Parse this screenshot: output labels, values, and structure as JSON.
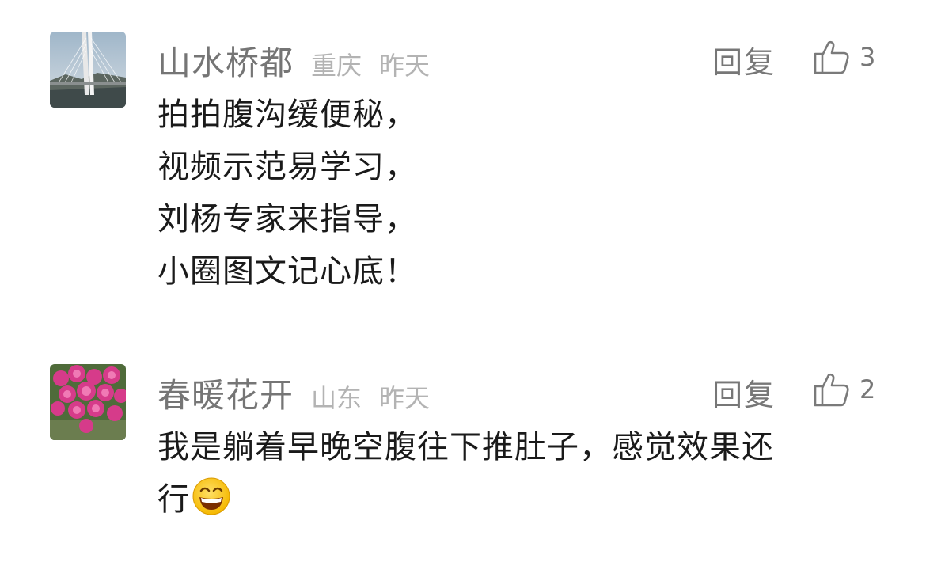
{
  "comments": [
    {
      "username": "山水桥都",
      "location": "重庆",
      "time": "昨天",
      "reply_label": "回复",
      "like_icon": "thumbs-up-icon",
      "like_count": "3",
      "avatar": "bridge-photo",
      "lines": [
        "拍拍腹沟缓便秘，",
        "视频示范易学习，",
        "刘杨专家来指导，",
        "小圈图文记心底！"
      ]
    },
    {
      "username": "春暖花开",
      "location": "山东",
      "time": "昨天",
      "reply_label": "回复",
      "like_icon": "thumbs-up-icon",
      "like_count": "2",
      "avatar": "flower-photo",
      "lines": [
        "我是躺着早晚空腹往下推肚子，感觉效果还",
        "行"
      ],
      "emoji": "grinning-face-emoji"
    }
  ],
  "colors": {
    "username": "#757575",
    "meta": "#b3b3b3",
    "body": "#1a1a1a",
    "action": "#777777"
  }
}
